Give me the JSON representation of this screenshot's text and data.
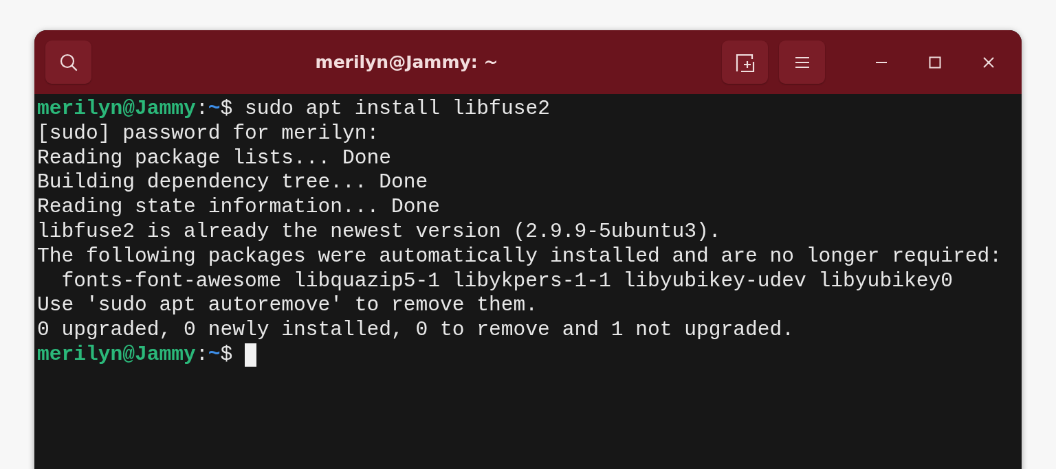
{
  "window": {
    "title": "merilyn@Jammy: ~"
  },
  "terminal": {
    "lines": [
      {
        "kind": "prompt",
        "user_host": "merilyn@Jammy",
        "separator": ":",
        "path": "~",
        "symbol": "$",
        "command": "sudo apt install libfuse2",
        "cursor": false
      },
      {
        "kind": "output",
        "text": "[sudo] password for merilyn:"
      },
      {
        "kind": "output",
        "text": "Reading package lists... Done"
      },
      {
        "kind": "output",
        "text": "Building dependency tree... Done"
      },
      {
        "kind": "output",
        "text": "Reading state information... Done"
      },
      {
        "kind": "output",
        "text": "libfuse2 is already the newest version (2.9.9-5ubuntu3)."
      },
      {
        "kind": "output",
        "text": "The following packages were automatically installed and are no longer required:"
      },
      {
        "kind": "output",
        "text": "  fonts-font-awesome libquazip5-1 libykpers-1-1 libyubikey-udev libyubikey0"
      },
      {
        "kind": "output",
        "text": "Use 'sudo apt autoremove' to remove them."
      },
      {
        "kind": "output",
        "text": "0 upgraded, 0 newly installed, 0 to remove and 1 not upgraded."
      },
      {
        "kind": "prompt",
        "user_host": "merilyn@Jammy",
        "separator": ":",
        "path": "~",
        "symbol": "$",
        "cursor": true
      }
    ]
  }
}
